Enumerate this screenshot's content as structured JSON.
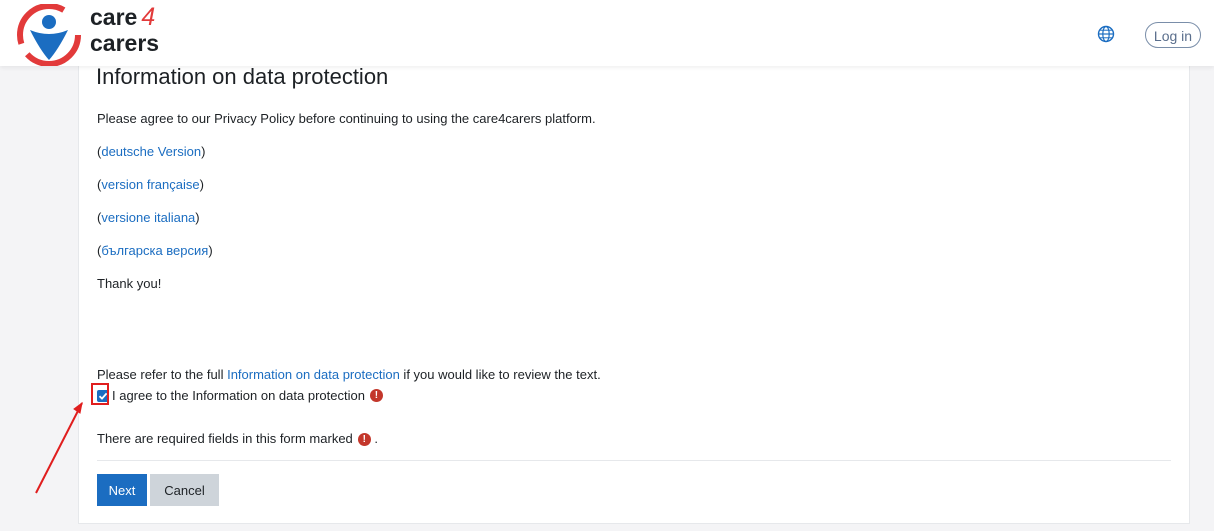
{
  "header": {
    "logo_line1": "care",
    "logo_four": "4",
    "logo_line2": "carers",
    "language_icon": "globe-icon",
    "login_label": "Log in"
  },
  "main": {
    "title": "Information on data protection",
    "intro": "Please agree to our Privacy Policy before continuing to using the care4carers platform.",
    "language_links": [
      {
        "open": "(",
        "label": "deutsche Version",
        "close": ")"
      },
      {
        "open": "(",
        "label": "version française",
        "close": ")"
      },
      {
        "open": "(",
        "label": "versione italiana",
        "close": ")"
      },
      {
        "open": "(",
        "label": "българска версия",
        "close": ")"
      }
    ],
    "thanks": "Thank you!",
    "refer_prefix": "Please refer to the full ",
    "refer_link": "Information on data protection",
    "refer_suffix": " if you would like to review the text.",
    "agree_label": "I agree to the Information on data protection",
    "agree_checked": true,
    "required_note": "There are required fields in this form marked",
    "required_note_end": "."
  },
  "buttons": {
    "next": "Next",
    "cancel": "Cancel"
  },
  "colors": {
    "link": "#1b6dc1",
    "primary": "#1b6dc1",
    "required": "#c3372b",
    "annotation": "#e01e1e"
  }
}
